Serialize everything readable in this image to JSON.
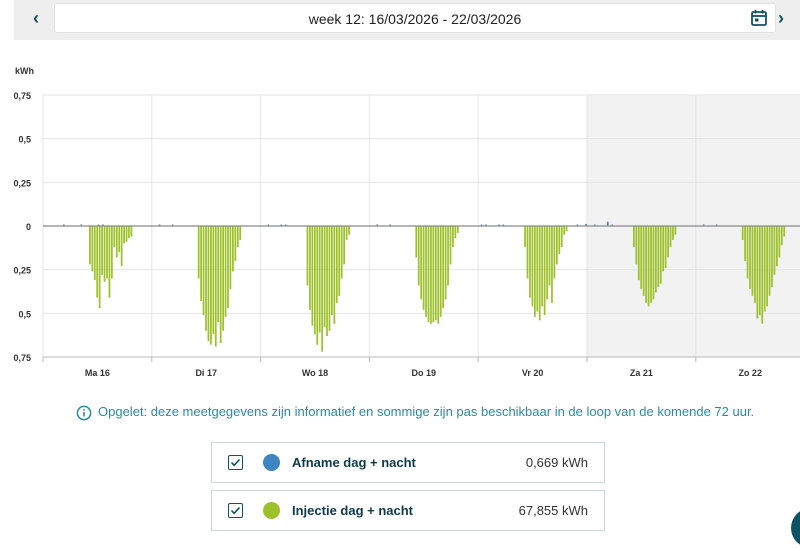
{
  "header": {
    "week_label": "week 12: 16/03/2026 - 22/03/2026",
    "prev_icon": "chevron-left-icon",
    "next_icon": "chevron-right-icon",
    "calendar_icon": "calendar-icon",
    "prev_label": "‹",
    "next_label": "›"
  },
  "chart_data": {
    "type": "bar",
    "ylabel": "kWh",
    "ylim": [
      -0.75,
      0.75
    ],
    "y_ticks": [
      0.75,
      0.5,
      0.25,
      0,
      -0.25,
      -0.5,
      -0.75
    ],
    "y_tick_labels": [
      "0,75",
      "0,5",
      "0,25",
      "0",
      "0,25",
      "0,5",
      "0,75"
    ],
    "x_categories": [
      "Ma 16",
      "Di 17",
      "Wo 18",
      "Do 19",
      "Vr 20",
      "Za 21",
      "Zo 22"
    ],
    "weekend_shaded": [
      "Za 21",
      "Zo 22"
    ],
    "series": [
      {
        "name": "Afname dag + nacht",
        "color": "#3f86c0",
        "days": [
          [
            0.005,
            0,
            0,
            0,
            0.004,
            0,
            0,
            0,
            0.006,
            0.005,
            0,
            0,
            0,
            0,
            0,
            0,
            0,
            0,
            0,
            0,
            0,
            0,
            0.004
          ],
          [
            0.004,
            0,
            0,
            0,
            0,
            0,
            0,
            0,
            0,
            0,
            0,
            0,
            0,
            0,
            0,
            0,
            0,
            0,
            0,
            0,
            0,
            0,
            0.004
          ],
          [
            0.006,
            0.004,
            0,
            0,
            0,
            0,
            0,
            0,
            0,
            0,
            0,
            0,
            0,
            0,
            0,
            0,
            0,
            0,
            0,
            0,
            0,
            0,
            0.004
          ],
          [
            0.004,
            0,
            0,
            0,
            0,
            0,
            0,
            0,
            0,
            0,
            0,
            0,
            0,
            0,
            0,
            0,
            0,
            0,
            0,
            0,
            0,
            0.003,
            0.004
          ],
          [
            0.006,
            0.005,
            0,
            0,
            0,
            0,
            0,
            0,
            0,
            0,
            0,
            0,
            0,
            0,
            0,
            0,
            0,
            0,
            0.005,
            0,
            0.012,
            0,
            0.004
          ],
          [
            0.025,
            0.006,
            0,
            0,
            0,
            0,
            0,
            0,
            0,
            0,
            0,
            0,
            0,
            0,
            0,
            0,
            0,
            0,
            0,
            0,
            0,
            0,
            0.004
          ],
          [
            0.004,
            0,
            0,
            0,
            0,
            0,
            0,
            0,
            0,
            0,
            0,
            0,
            0,
            0,
            0,
            0,
            0,
            0,
            0,
            0,
            0,
            0,
            0.004
          ]
        ]
      },
      {
        "name": "Injectie dag + nacht",
        "color": "#9dc12b",
        "days": [
          [
            0.22,
            0.26,
            0.31,
            0.41,
            0.47,
            0.28,
            0.32,
            0.3,
            0.41,
            0.3,
            0.12,
            0.18,
            0.15,
            0.23,
            0.1,
            0.09,
            0.07,
            0.06
          ],
          [
            0.3,
            0.43,
            0.51,
            0.6,
            0.66,
            0.68,
            0.62,
            0.69,
            0.55,
            0.67,
            0.6,
            0.52,
            0.47,
            0.36,
            0.26,
            0.2,
            0.12,
            0.08
          ],
          [
            0.34,
            0.48,
            0.57,
            0.62,
            0.68,
            0.61,
            0.72,
            0.58,
            0.63,
            0.6,
            0.51,
            0.56,
            0.44,
            0.4,
            0.3,
            0.22,
            0.08,
            0.05
          ],
          [
            0.18,
            0.34,
            0.42,
            0.48,
            0.52,
            0.55,
            0.56,
            0.55,
            0.54,
            0.56,
            0.52,
            0.47,
            0.42,
            0.34,
            0.22,
            0.12,
            0.07,
            0.04
          ],
          [
            0.12,
            0.3,
            0.41,
            0.46,
            0.52,
            0.49,
            0.54,
            0.46,
            0.51,
            0.42,
            0.34,
            0.44,
            0.3,
            0.22,
            0.16,
            0.12,
            0.05,
            0.03
          ],
          [
            0.12,
            0.22,
            0.31,
            0.36,
            0.4,
            0.44,
            0.46,
            0.44,
            0.42,
            0.38,
            0.35,
            0.33,
            0.26,
            0.24,
            0.18,
            0.12,
            0.08,
            0.05
          ],
          [
            0.08,
            0.2,
            0.3,
            0.36,
            0.4,
            0.44,
            0.53,
            0.51,
            0.56,
            0.49,
            0.46,
            0.4,
            0.35,
            0.28,
            0.23,
            0.18,
            0.11,
            0.06
          ]
        ]
      }
    ]
  },
  "info": {
    "icon": "info-icon",
    "text": "Opgelet: deze meetgegevens zijn informatief en sommige zijn pas beschikbaar in de loop van de komende 72 uur."
  },
  "legend": [
    {
      "label": "Afname dag + nacht",
      "value": "0,669 kWh",
      "color": "#3f86c0",
      "checked": true
    },
    {
      "label": "Injectie dag + nacht",
      "value": "67,855 kWh",
      "color": "#9dc12b",
      "checked": true
    }
  ]
}
